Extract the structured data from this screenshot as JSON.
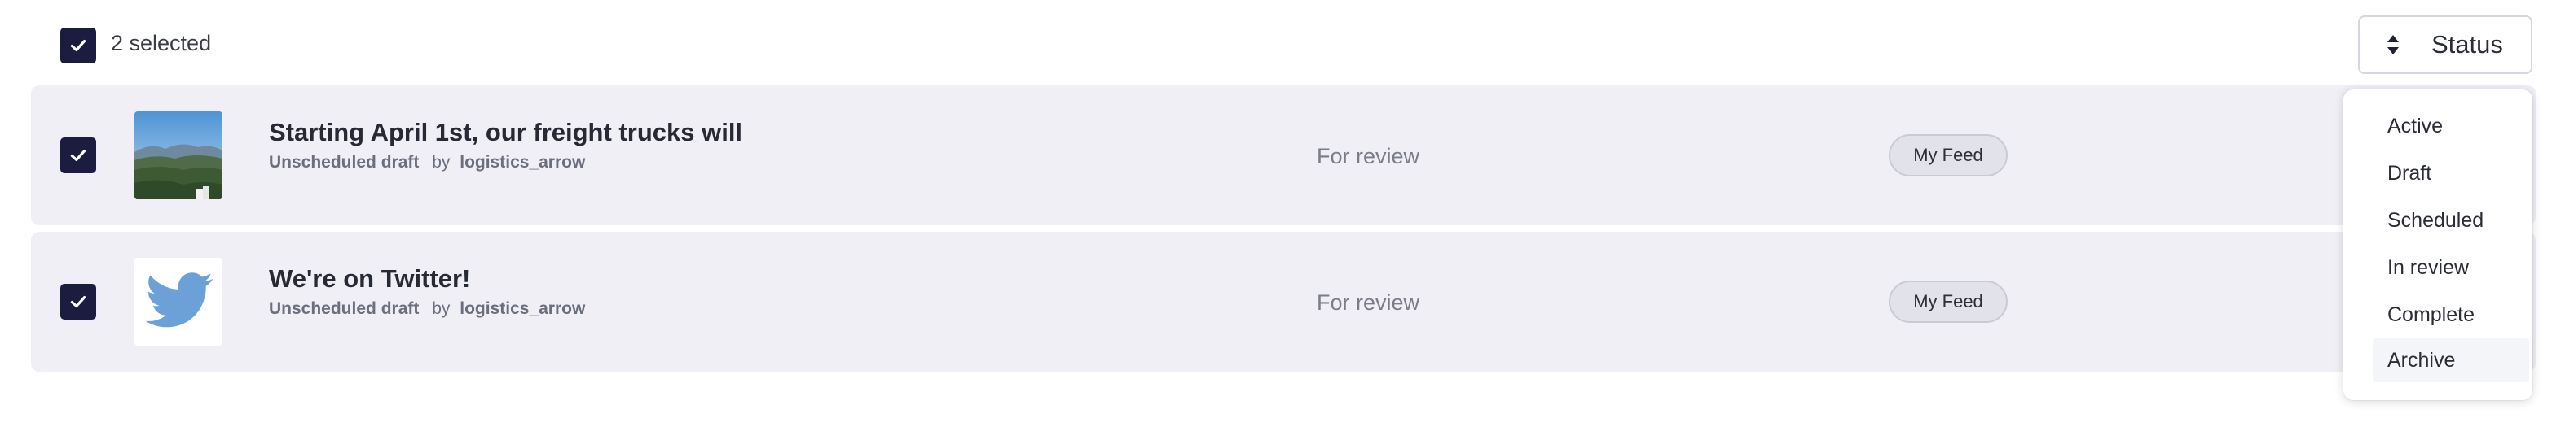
{
  "header": {
    "selected_label": "2 selected",
    "status_button_label": "Status"
  },
  "rows": [
    {
      "title": "Starting April 1st, our freight trucks will",
      "draft_label": "Unscheduled draft",
      "by_label": "by",
      "author": "logistics_arrow",
      "review_status": "For review",
      "feed_badge": "My Feed",
      "thumbnail_icon": "landscape-photo",
      "checked": true
    },
    {
      "title": "We're on Twitter!",
      "draft_label": "Unscheduled draft",
      "by_label": "by",
      "author": "logistics_arrow",
      "review_status": "For review",
      "feed_badge": "My Feed",
      "thumbnail_icon": "twitter-bird-icon",
      "checked": true
    }
  ],
  "status_menu": {
    "items": [
      "Active",
      "Draft",
      "Scheduled",
      "In review",
      "Complete",
      "Archive"
    ],
    "highlighted": "Archive"
  },
  "colors": {
    "checkbox_fill": "#1b1c3f",
    "row_background": "#efeff5",
    "twitter_blue": "#6ca1d8"
  }
}
